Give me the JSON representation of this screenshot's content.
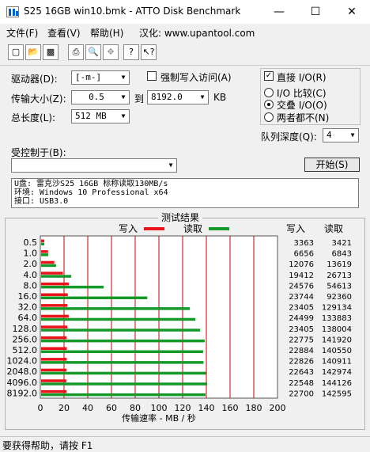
{
  "window": {
    "title": "S25 16GB win10.bmk - ATTO Disk Benchmark",
    "minimize_glyph": "—",
    "maximize_glyph": "☐",
    "close_glyph": "✕"
  },
  "menu": [
    "文件(F)",
    "查看(V)",
    "帮助(H)",
    "汉化: www.upantool.com"
  ],
  "toolbar_icons": [
    "new-icon",
    "open-icon",
    "save-icon",
    "print-icon",
    "print-preview-icon",
    "move-icon",
    "help-icon",
    "context-help-icon"
  ],
  "settings": {
    "drive_label": "驱动器(D):",
    "drive_value": "[-m-]",
    "force_write_label": "强制写入访问(A)",
    "transfer_size_label": "传输大小(Z):",
    "transfer_from": "0.5",
    "to_label": "到",
    "transfer_to": "8192.0",
    "kb_label": "KB",
    "total_length_label": "总长度(L):",
    "total_length_value": "512 MB",
    "direct_io_label": "直接 I/O(R)",
    "io_compare_label": "I/O 比较(C)",
    "overlapped_io_label": "交叠 I/O(O)",
    "neither_label": "两者都不(N)",
    "queue_depth_label": "队列深度(Q):",
    "queue_depth_value": "4",
    "controlled_by_label": "受控制于(B):",
    "controlled_by_value": "",
    "start_button": "开始(S)"
  },
  "description": [
    "U盘: 雷克沙S25 16GB 标称读取130MB/s",
    "环境: Windows 10 Professional x64",
    "接口: USB3.0"
  ],
  "results": {
    "title": "测试结果",
    "write_legend": "写入",
    "read_legend": "读取",
    "write_col": "写入",
    "read_col": "读取",
    "xlabel": "传输速率 - MB / 秒"
  },
  "colors": {
    "write": "#e8141a",
    "read": "#159a2a",
    "grid": "#c80000"
  },
  "chart_data": {
    "type": "bar",
    "categories": [
      "0.5",
      "1.0",
      "2.0",
      "4.0",
      "8.0",
      "16.0",
      "32.0",
      "64.0",
      "128.0",
      "256.0",
      "512.0",
      "1024.0",
      "2048.0",
      "4096.0",
      "8192.0"
    ],
    "series": [
      {
        "name": "写入",
        "values": [
          3363,
          6656,
          12076,
          19412,
          24576,
          23744,
          23405,
          24499,
          23405,
          22775,
          22884,
          22826,
          22643,
          22548,
          22700
        ]
      },
      {
        "name": "读取",
        "values": [
          3421,
          6843,
          13619,
          26713,
          54613,
          92360,
          129134,
          133883,
          138004,
          141920,
          140550,
          140911,
          142974,
          144126,
          142595
        ]
      }
    ],
    "xlim": [
      0,
      200
    ],
    "xticks": [
      0,
      20,
      40,
      60,
      80,
      100,
      120,
      140,
      160,
      180,
      200
    ],
    "xlabel": "传输速率 - MB / 秒"
  },
  "status": "要获得帮助，请按 F1"
}
